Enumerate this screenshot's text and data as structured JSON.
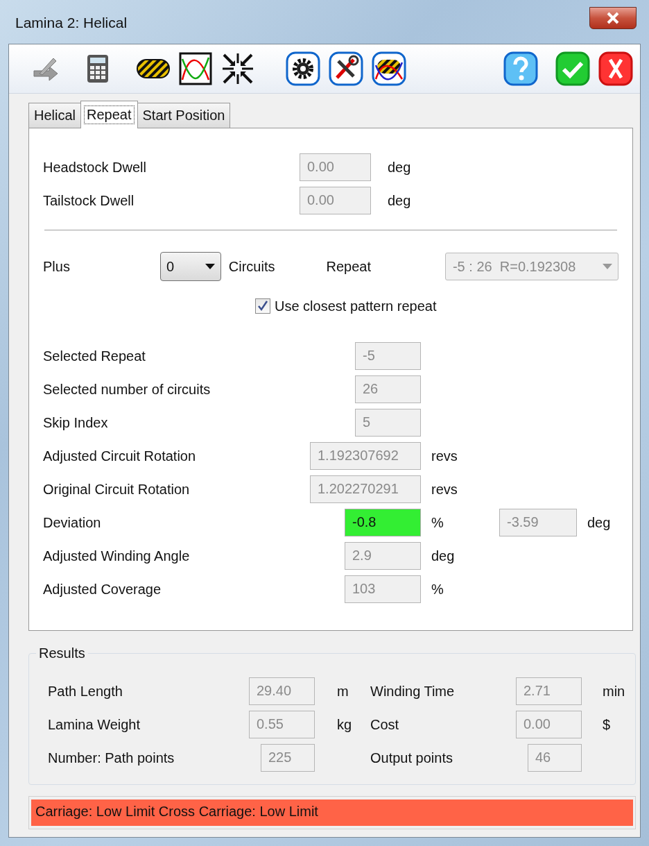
{
  "window": {
    "title": "Lamina 2: Helical"
  },
  "tabs": [
    {
      "label": "Helical",
      "selected": false
    },
    {
      "label": "Repeat",
      "selected": true
    },
    {
      "label": "Start Position",
      "selected": false
    }
  ],
  "dwell": [
    {
      "label": "Headstock Dwell",
      "value": "0.00",
      "unit": "deg"
    },
    {
      "label": "Tailstock Dwell",
      "value": "0.00",
      "unit": "deg"
    }
  ],
  "plus": {
    "label": "Plus",
    "value": "0",
    "unit": "Circuits"
  },
  "repeat": {
    "label": "Repeat",
    "value": "-5 : 26  R=0.192308"
  },
  "closest_pattern": {
    "label": "Use closest pattern repeat",
    "checked": true
  },
  "rows": [
    {
      "label": "Selected Repeat",
      "value": "-5",
      "highlighted": false
    },
    {
      "label": "Selected number of circuits",
      "value": "26",
      "highlighted": false
    },
    {
      "label": "Skip Index",
      "value": "5",
      "highlighted": false
    },
    {
      "label": "Adjusted Circuit Rotation",
      "value": "1.192307692",
      "unit": "revs",
      "highlighted": false
    },
    {
      "label": "Original Circuit Rotation",
      "value": "1.202270291",
      "unit": "revs",
      "highlighted": false
    },
    {
      "label": "Deviation",
      "value": "-0.8",
      "unit": "%",
      "highlighted": true,
      "extra_value": "-3.59",
      "extra_unit": "deg"
    },
    {
      "label": "Adjusted Winding Angle",
      "value": "2.9",
      "unit": "deg",
      "highlighted": false
    },
    {
      "label": "Adjusted Coverage",
      "value": "103",
      "unit": "%",
      "highlighted": false
    }
  ],
  "results": {
    "title": "Results",
    "items": [
      {
        "label": "Path Length",
        "value": "29.40",
        "unit": "m"
      },
      {
        "label": "Winding Time",
        "value": "2.71",
        "unit": "min"
      },
      {
        "label": "Lamina Weight",
        "value": "0.55",
        "unit": "kg"
      },
      {
        "label": "Cost",
        "value": "0.00",
        "unit": "$"
      },
      {
        "label": "Number: Path points",
        "value": "225"
      },
      {
        "label": "Output points",
        "value": "46"
      }
    ]
  },
  "status_bar": {
    "text": "Carriage: Low Limit Cross Carriage: Low Limit"
  }
}
